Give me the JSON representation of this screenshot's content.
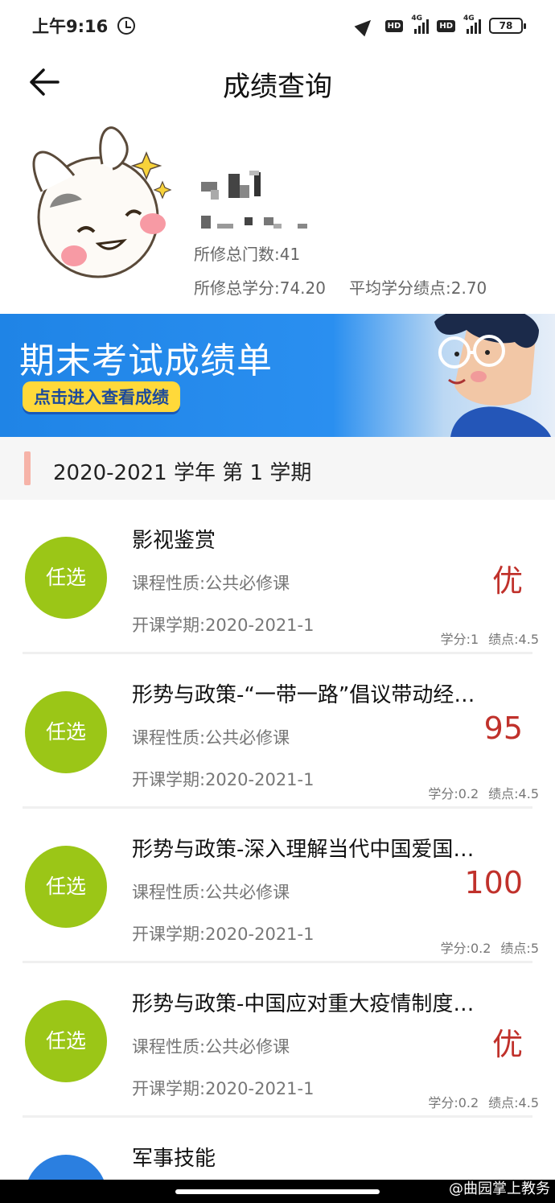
{
  "status_bar": {
    "time": "上午9:16",
    "hd1": "HD",
    "hd2": "HD",
    "network1": "4G",
    "network2": "4G",
    "battery": "78"
  },
  "header": {
    "title": "成绩查询"
  },
  "profile": {
    "total_courses": "所修总门数:41",
    "total_credits": "所修总学分:74.20",
    "gpa": "平均学分绩点:2.70"
  },
  "banner": {
    "title": "期末考试成绩单",
    "button": "点击进入查看成绩"
  },
  "semester": {
    "label": "2020-2021 学年 第 1 学期"
  },
  "courses": [
    {
      "badge": "任选",
      "name": "影视鉴赏",
      "type": "课程性质:公共必修课",
      "term": "开课学期:2020-2021-1",
      "score": "优",
      "credit": "学分:1",
      "gpa": "绩点:4.5"
    },
    {
      "badge": "任选",
      "name": "形势与政策-“一带一路”倡议带动经…",
      "type": "课程性质:公共必修课",
      "term": "开课学期:2020-2021-1",
      "score": "95",
      "credit": "学分:0.2",
      "gpa": "绩点:4.5"
    },
    {
      "badge": "任选",
      "name": "形势与政策-深入理解当代中国爱国…",
      "type": "课程性质:公共必修课",
      "term": "开课学期:2020-2021-1",
      "score": "100",
      "credit": "学分:0.2",
      "gpa": "绩点:5"
    },
    {
      "badge": "任选",
      "name": "形势与政策-中国应对重大疫情制度…",
      "type": "课程性质:公共必修课",
      "term": "开课学期:2020-2021-1",
      "score": "优",
      "credit": "学分:0.2",
      "gpa": "绩点:4.5"
    },
    {
      "name": "军事技能"
    }
  ],
  "watermark": "@曲园掌上教务",
  "colors": {
    "badge_green": "#9bc617",
    "badge_blue": "#2b7fe0",
    "score_red": "#c0312b",
    "banner_blue": "#1f84e6",
    "accent_pink": "#f6b3a8"
  }
}
